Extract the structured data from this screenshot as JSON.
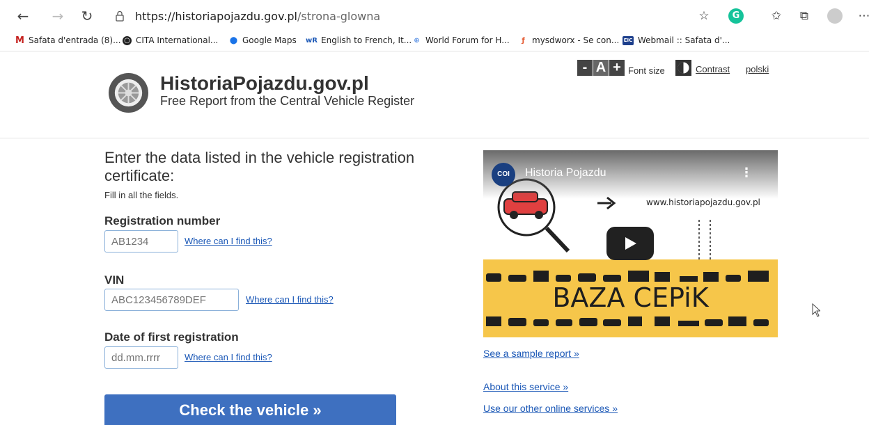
{
  "browser": {
    "url_host": "https://historiapojazdu.gov.pl",
    "url_path": "/strona-glowna",
    "bookmarks": [
      {
        "label": "Safata d'entrada (8)...",
        "icon": "gmail-icon",
        "color": "#c5221f"
      },
      {
        "label": "CITA International...",
        "icon": "cita-icon",
        "color": "#222222"
      },
      {
        "label": "Google Maps",
        "icon": "google-maps-icon",
        "color": "#1a73e8"
      },
      {
        "label": "English to French, It...",
        "icon": "wordreference-icon",
        "color": "#1a57b6"
      },
      {
        "label": "World Forum for H...",
        "icon": "un-icon",
        "color": "#5b92e5"
      },
      {
        "label": "mysdworx - Se con...",
        "icon": "sdworx-icon",
        "color": "#e4572e"
      },
      {
        "label": "Webmail :: Safata d'...",
        "icon": "eic-icon",
        "color": "#1d3f8c"
      }
    ]
  },
  "header": {
    "title": "HistoriaPojazdu.gov.pl",
    "subtitle": "Free Report from the Central Vehicle Register",
    "font_decrease": "-",
    "font_default": "A",
    "font_increase": "+",
    "font_size_label": "Font size",
    "contrast_label": "Contrast",
    "language_label": "polski"
  },
  "form": {
    "heading": "Enter the data listed in the vehicle registration certificate:",
    "hint": "Fill in all the fields.",
    "registration": {
      "label": "Registration number",
      "placeholder": "AB1234",
      "help": "Where can I find this?"
    },
    "vin": {
      "label": "VIN",
      "placeholder": "ABC123456789DEF",
      "help": "Where can I find this?"
    },
    "date": {
      "label": "Date of first registration",
      "placeholder": "dd.mm.rrrr",
      "help": "Where can I find this?"
    },
    "submit": "Check the vehicle »"
  },
  "video": {
    "channel_logo": "COI",
    "title": "Historia Pojazdu",
    "url_text": "www.historiapojazdu.gov.pl",
    "banner": "BAZA CEPiK",
    "accent": "#f6c64a"
  },
  "side_links": {
    "sample": "See a sample report »",
    "about": "About this service »",
    "other": "Use our other online services »"
  }
}
